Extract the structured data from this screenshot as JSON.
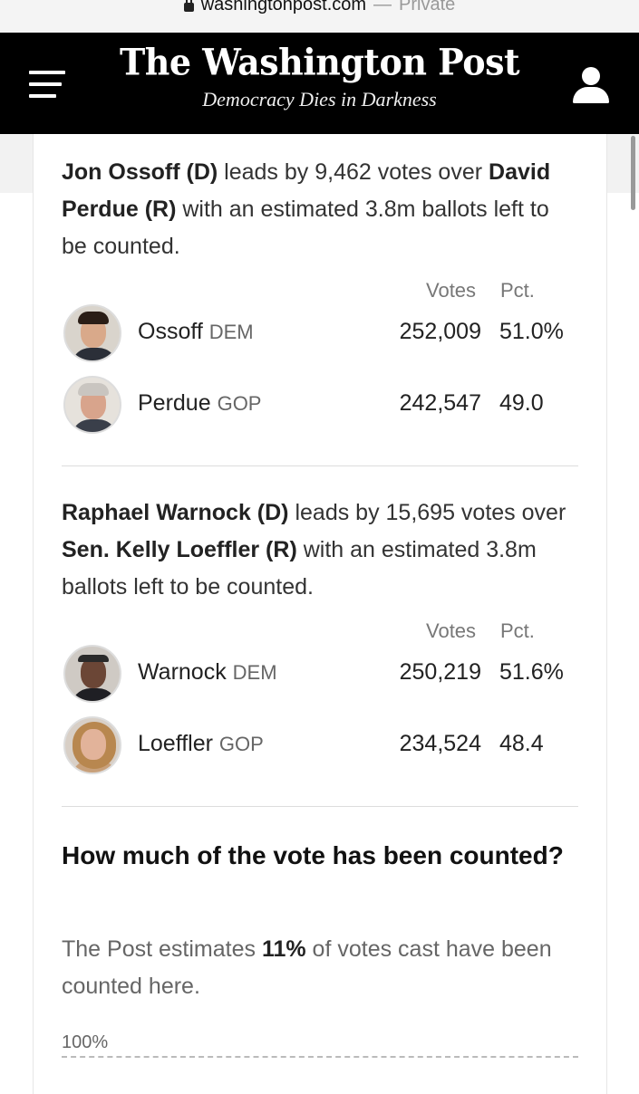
{
  "browser": {
    "url": "washingtonpost.com",
    "separator": "—",
    "mode": "Private"
  },
  "header": {
    "logo": "The Washington Post",
    "tagline": "Democracy Dies in Darkness"
  },
  "races": [
    {
      "summary": {
        "leader": "Jon Ossoff (D)",
        "lead_text": " leads by 9,462 votes over ",
        "trailer": "David Perdue (R)",
        "rest": " with an estimated 3.8m ballots left to be counted."
      },
      "col_votes": "Votes",
      "col_pct": "Pct.",
      "candidates": [
        {
          "name": "Ossoff",
          "party": "DEM",
          "votes": "252,009",
          "pct": "51.0%"
        },
        {
          "name": "Perdue",
          "party": "GOP",
          "votes": "242,547",
          "pct": "49.0"
        }
      ]
    },
    {
      "summary": {
        "leader": "Raphael Warnock (D)",
        "lead_text": " leads by 15,695 votes over ",
        "trailer": "Sen. Kelly Loeffler (R)",
        "rest": " with an estimated 3.8m ballots left to be counted."
      },
      "col_votes": "Votes",
      "col_pct": "Pct.",
      "candidates": [
        {
          "name": "Warnock",
          "party": "DEM",
          "votes": "250,219",
          "pct": "51.6%"
        },
        {
          "name": "Loeffler",
          "party": "GOP",
          "votes": "234,524",
          "pct": "48.4"
        }
      ]
    }
  ],
  "counted": {
    "title": "How much of the vote has been counted?",
    "text_before": "The Post estimates ",
    "percent": "11%",
    "text_after": " of votes cast have been counted here.",
    "axis_label": "100%"
  }
}
